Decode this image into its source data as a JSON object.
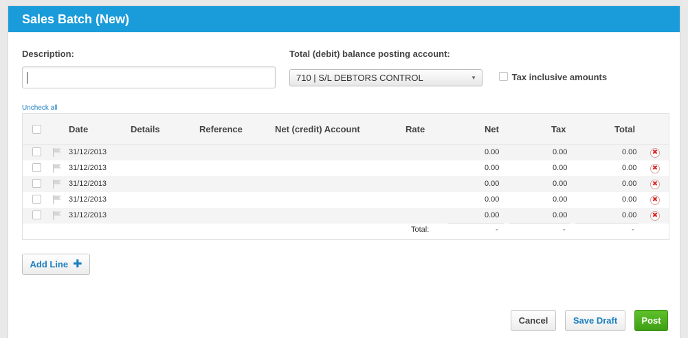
{
  "header": {
    "title": "Sales Batch (New)"
  },
  "form": {
    "description_label": "Description:",
    "description_value": "",
    "posting_account_label": "Total (debit) balance posting account:",
    "posting_account_value": "710 | S/L DEBTORS CONTROL",
    "tax_inclusive_label": "Tax inclusive amounts",
    "tax_inclusive_checked": false
  },
  "grid": {
    "uncheck_all": "Uncheck all",
    "columns": [
      "Date",
      "Details",
      "Reference",
      "Net (credit) Account",
      "Rate",
      "Net",
      "Tax",
      "Total"
    ],
    "rows": [
      {
        "date": "31/12/2013",
        "details": "",
        "reference": "",
        "account": "",
        "rate": "",
        "net": "0.00",
        "tax": "0.00",
        "total": "0.00"
      },
      {
        "date": "31/12/2013",
        "details": "",
        "reference": "",
        "account": "",
        "rate": "",
        "net": "0.00",
        "tax": "0.00",
        "total": "0.00"
      },
      {
        "date": "31/12/2013",
        "details": "",
        "reference": "",
        "account": "",
        "rate": "",
        "net": "0.00",
        "tax": "0.00",
        "total": "0.00"
      },
      {
        "date": "31/12/2013",
        "details": "",
        "reference": "",
        "account": "",
        "rate": "",
        "net": "0.00",
        "tax": "0.00",
        "total": "0.00"
      },
      {
        "date": "31/12/2013",
        "details": "",
        "reference": "",
        "account": "",
        "rate": "",
        "net": "0.00",
        "tax": "0.00",
        "total": "0.00"
      }
    ],
    "totals": {
      "label": "Total:",
      "net": "-",
      "tax": "-",
      "total": "-"
    }
  },
  "buttons": {
    "add_line": "Add Line",
    "cancel": "Cancel",
    "save_draft": "Save Draft",
    "post": "Post"
  },
  "colors": {
    "header": "#1a9bda",
    "post": "#4caf1f",
    "link": "#1a7fc1"
  }
}
